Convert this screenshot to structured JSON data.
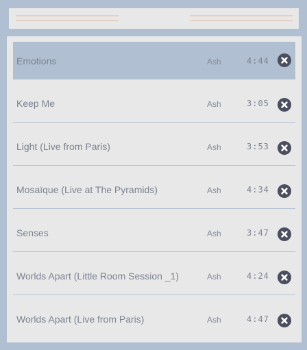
{
  "header": {
    "decorations": "line-pair"
  },
  "tracks": [
    {
      "title": "Emotions",
      "artist": "Ash",
      "duration": "4:44",
      "active": true
    },
    {
      "title": "Keep Me",
      "artist": "Ash",
      "duration": "3:05",
      "active": false
    },
    {
      "title": "Light (Live from Paris)",
      "artist": "Ash",
      "duration": "3:53",
      "active": false
    },
    {
      "title": "Mosaïque (Live at The Pyramids)",
      "artist": "Ash",
      "duration": "4:34",
      "active": false
    },
    {
      "title": "Senses",
      "artist": "Ash",
      "duration": "3:47",
      "active": false
    },
    {
      "title": "Worlds Apart (Little Room Session _1)",
      "artist": "Ash",
      "duration": "4:24",
      "active": false
    },
    {
      "title": "Worlds Apart (Live from Paris)",
      "artist": "Ash",
      "duration": "4:47",
      "active": false
    }
  ],
  "icons": {
    "remove": "close-circle-icon"
  },
  "colors": {
    "background": "#b0bfd1",
    "panel": "#e8e8e8",
    "active_row": "#b0bfd1",
    "remove_button": "#4b4e5e",
    "header_lines": "#e5cfc0"
  }
}
